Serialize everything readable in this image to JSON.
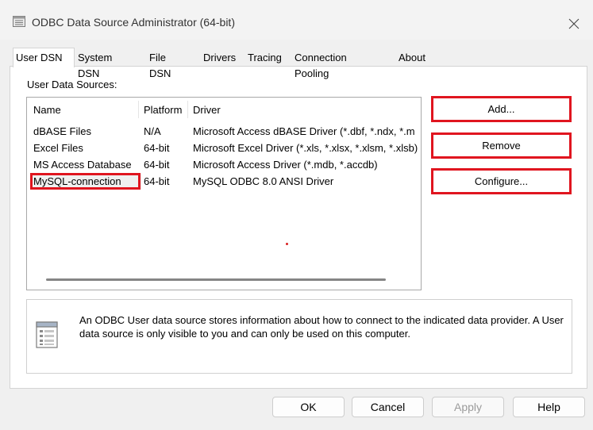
{
  "window": {
    "title": "ODBC Data Source Administrator (64-bit)"
  },
  "tabs": [
    {
      "label": "User DSN",
      "active": true
    },
    {
      "label": "System DSN"
    },
    {
      "label": "File DSN"
    },
    {
      "label": "Drivers"
    },
    {
      "label": "Tracing"
    },
    {
      "label": "Connection Pooling"
    },
    {
      "label": "About"
    }
  ],
  "section_label": "User Data Sources:",
  "columns": {
    "name": "Name",
    "platform": "Platform",
    "driver": "Driver"
  },
  "rows": [
    {
      "name": "dBASE Files",
      "platform": "N/A",
      "driver": "Microsoft Access dBASE Driver (*.dbf, *.ndx, *.m"
    },
    {
      "name": "Excel Files",
      "platform": "64-bit",
      "driver": "Microsoft Excel Driver (*.xls, *.xlsx, *.xlsm, *.xlsb)"
    },
    {
      "name": "MS Access Database",
      "platform": "64-bit",
      "driver": "Microsoft Access Driver (*.mdb, *.accdb)"
    },
    {
      "name": "MySQL-connection",
      "platform": "64-bit",
      "driver": "MySQL ODBC 8.0 ANSI Driver",
      "selected": true
    }
  ],
  "side_buttons": {
    "add": "Add...",
    "remove": "Remove",
    "configure": "Configure..."
  },
  "info_text": "An ODBC User data source stores information about how to connect to the indicated data provider.   A User data source is only visible to you and can only be used on this computer.",
  "dialog_buttons": {
    "ok": "OK",
    "cancel": "Cancel",
    "apply": "Apply",
    "help": "Help"
  },
  "colors": {
    "highlight": "#e0151f",
    "selection": "#f0f0f0"
  }
}
